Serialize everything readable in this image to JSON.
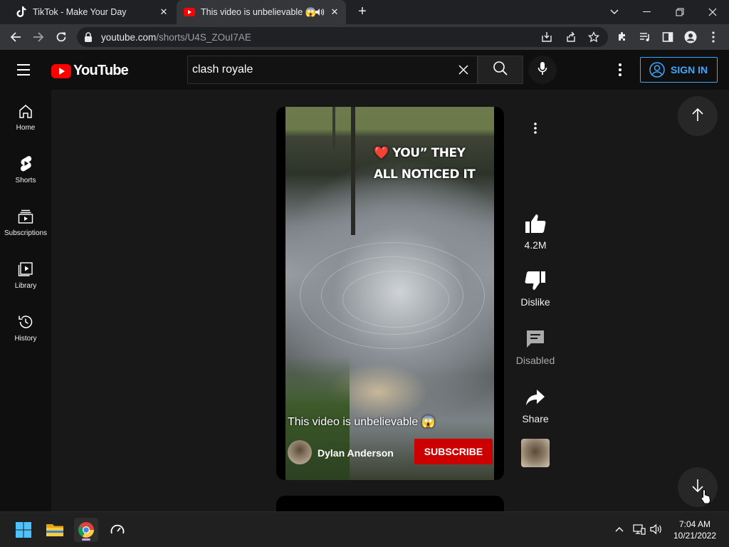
{
  "browser": {
    "tabs": [
      {
        "title": "TikTok - Make Your Day",
        "favicon": "tiktok-icon"
      },
      {
        "title": "This video is unbelievable 😱",
        "favicon": "youtube-icon",
        "active": true
      }
    ],
    "tab_close_glyph": "✕",
    "new_tab_glyph": "+",
    "url_host": "youtube.com",
    "url_path": "/shorts/U4S_ZOuI7AE"
  },
  "youtube": {
    "logo_text": "YouTube",
    "search_value": "clash royale",
    "sign_in_label": "SIGN IN",
    "sidebar": [
      {
        "label": "Home",
        "icon": "home-icon"
      },
      {
        "label": "Shorts",
        "icon": "shorts-icon"
      },
      {
        "label": "Subscriptions",
        "icon": "subscriptions-icon"
      },
      {
        "label": "Library",
        "icon": "library-icon"
      },
      {
        "label": "History",
        "icon": "history-icon"
      }
    ],
    "short": {
      "overlay_line1": "❤️ YOU” THEY",
      "overlay_line2": "ALL NOTICED IT",
      "title": "This video is unbelievable 😱",
      "channel": "Dylan Anderson",
      "subscribe_label": "SUBSCRIBE"
    },
    "actions": {
      "likes": "4.2M",
      "dislike": "Dislike",
      "comments": "Disabled",
      "share": "Share"
    }
  },
  "taskbar": {
    "time": "7:04 AM",
    "date": "10/21/2022"
  },
  "colors": {
    "accent_blue": "#3ea6ff",
    "subscribe_red": "#cc0000",
    "yt_red": "#ff0000"
  }
}
